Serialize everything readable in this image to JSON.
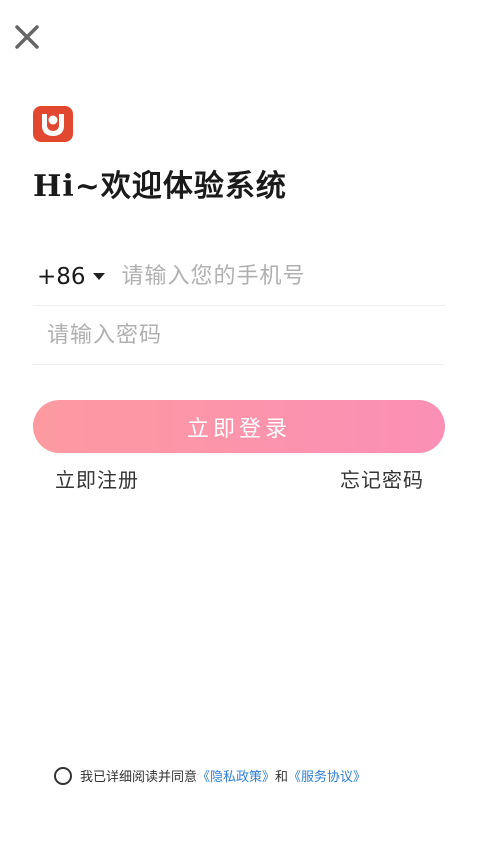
{
  "header": {
    "close_icon": "close-icon"
  },
  "brand": {
    "logo_icon": "app-logo-icon",
    "logo_color": "#e2472f"
  },
  "welcome": {
    "title": "Hi~欢迎体验系统"
  },
  "form": {
    "country_code": "+86",
    "phone_placeholder": "请输入您的手机号",
    "password_placeholder": "请输入密码",
    "login_label": "立即登录",
    "login_gradient": [
      "#fc9aa0",
      "#fb8fb6"
    ]
  },
  "links": {
    "register_label": "立即注册",
    "forgot_label": "忘记密码"
  },
  "agreement": {
    "prefix": "我已详细阅读并同意",
    "privacy_label": "《隐私政策》",
    "conjunction": "和",
    "service_label": "《服务协议》",
    "link_color": "#2f7fd8"
  }
}
